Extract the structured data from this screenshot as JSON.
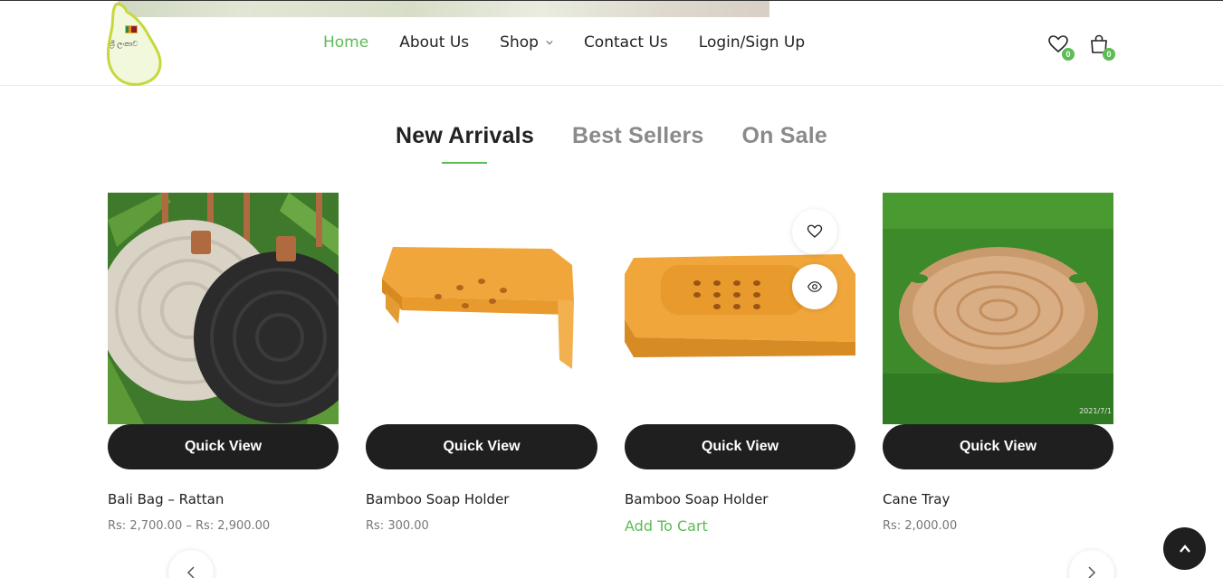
{
  "header": {
    "nav": [
      {
        "label": "Home",
        "active": true
      },
      {
        "label": "About Us",
        "active": false
      },
      {
        "label": "Shop",
        "active": false,
        "has_dropdown": true
      },
      {
        "label": "Contact Us",
        "active": false
      },
      {
        "label": "Login/Sign Up",
        "active": false
      }
    ],
    "wishlist_count": "0",
    "cart_count": "0",
    "logo_icon": "sri-lanka-map-logo-icon"
  },
  "tabs": [
    {
      "label": "New Arrivals",
      "active": true
    },
    {
      "label": "Best Sellers",
      "active": false
    },
    {
      "label": "On Sale",
      "active": false
    }
  ],
  "products": [
    {
      "title": "Bali Bag – Rattan",
      "price": "Rs: 2,700.00 – Rs: 2,900.00",
      "quick_view": "Quick View"
    },
    {
      "title": "Bamboo Soap Holder",
      "price": "Rs: 300.00",
      "quick_view": "Quick View"
    },
    {
      "title": "Bamboo Soap Holder",
      "add_to_cart": "Add To Cart",
      "quick_view": "Quick View"
    },
    {
      "title": "Cane Tray",
      "price": "Rs: 2,000.00",
      "quick_view": "Quick View",
      "image_watermark": "2021/7/1"
    }
  ],
  "colors": {
    "accent": "#5cbc55",
    "dark_button": "#1f1f1f",
    "muted_tab": "#8a8a8a"
  }
}
